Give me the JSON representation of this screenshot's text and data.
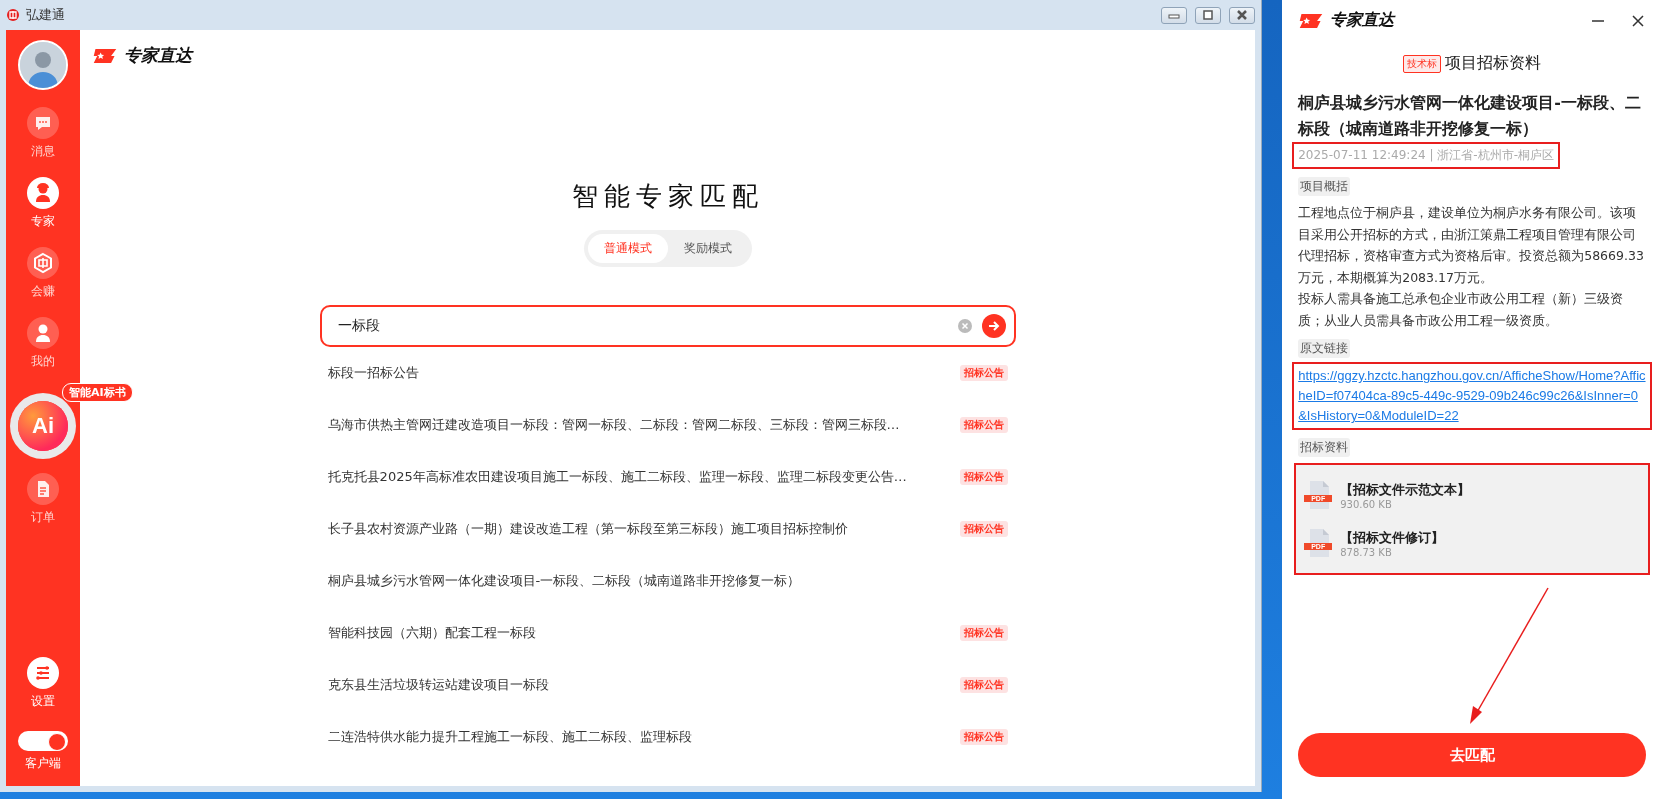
{
  "window": {
    "title": "弘建通"
  },
  "sidebar": {
    "items": [
      {
        "label": "消息",
        "selected": false
      },
      {
        "label": "专家",
        "selected": true
      },
      {
        "label": "会赚",
        "selected": false
      },
      {
        "label": "我的",
        "selected": false
      }
    ],
    "ai_button": {
      "label": "Ai",
      "badge": "智能AI标书"
    },
    "bottom_items": [
      {
        "label": "订单",
        "selected": false
      }
    ],
    "settings": {
      "label": "设置"
    },
    "client_toggle": {
      "label": "客户端",
      "on": true
    }
  },
  "main": {
    "brand": "专家直达",
    "title": "智能专家匹配",
    "modes": [
      {
        "label": "普通模式",
        "selected": true
      },
      {
        "label": "奖励模式",
        "selected": false
      }
    ],
    "search": {
      "value": "一标段"
    },
    "results": [
      {
        "text": "标段一招标公告",
        "tag": "招标公告"
      },
      {
        "text": "乌海市供热主管网迁建改造项目一标段：管网一标段、二标段：管网二标段、三标段：管网三标段…",
        "tag": "招标公告"
      },
      {
        "text": "托克托县2025年高标准农田建设项目施工一标段、施工二标段、监理一标段、监理二标段变更公告…",
        "tag": "招标公告"
      },
      {
        "text": "长子县农村资源产业路（一期）建设改造工程（第一标段至第三标段）施工项目招标控制价",
        "tag": "招标公告"
      },
      {
        "text": "桐庐县城乡污水管网一体化建设项目-一标段、二标段（城南道路非开挖修复一标）"
      },
      {
        "text": "智能科技园（六期）配套工程一标段",
        "tag": "招标公告"
      },
      {
        "text": "克东县生活垃圾转运站建设项目一标段",
        "tag": "招标公告"
      },
      {
        "text": "二连浩特供水能力提升工程施工一标段、施工二标段、监理标段",
        "tag": "招标公告"
      }
    ]
  },
  "detail_panel": {
    "brand": "专家直达",
    "tag": "技术标",
    "heading": "项目招标资料",
    "title": "桐庐县城乡污水管网一体化建设项目-一标段、二标段（城南道路非开挖修复一标）",
    "meta": {
      "text": "2025-07-11 12:49:24 | 浙江省-杭州市-桐庐区",
      "highlighted": true
    },
    "summary": {
      "label": "项目概括",
      "paragraphs": [
        "工程地点位于桐庐县，建设单位为桐庐水务有限公司。该项目采用公开招标的方式，由浙江策鼎工程项目管理有限公司代理招标，资格审查方式为资格后审。投资总额为58669.33万元，本期概算为2083.17万元。",
        "投标人需具备施工总承包企业市政公用工程（新）三级资质；从业人员需具备市政公用工程一级资质。"
      ]
    },
    "link": {
      "label": "原文链接",
      "url": "https://ggzy.hzctc.hangzhou.gov.cn/AfficheShow/Home?AfficheID=f07404ca-89c5-449c-9529-09b246c99c26&IsInner=0&IsHistory=0&ModuleID=22",
      "highlighted": true
    },
    "files": {
      "label": "招标资料",
      "highlighted": true,
      "items": [
        {
          "name": "【招标文件示范文本】",
          "type": "PDF",
          "size": "930.60 KB"
        },
        {
          "name": "【招标文件修订】",
          "type": "PDF",
          "size": "878.73 KB"
        }
      ]
    },
    "action": "去匹配"
  }
}
